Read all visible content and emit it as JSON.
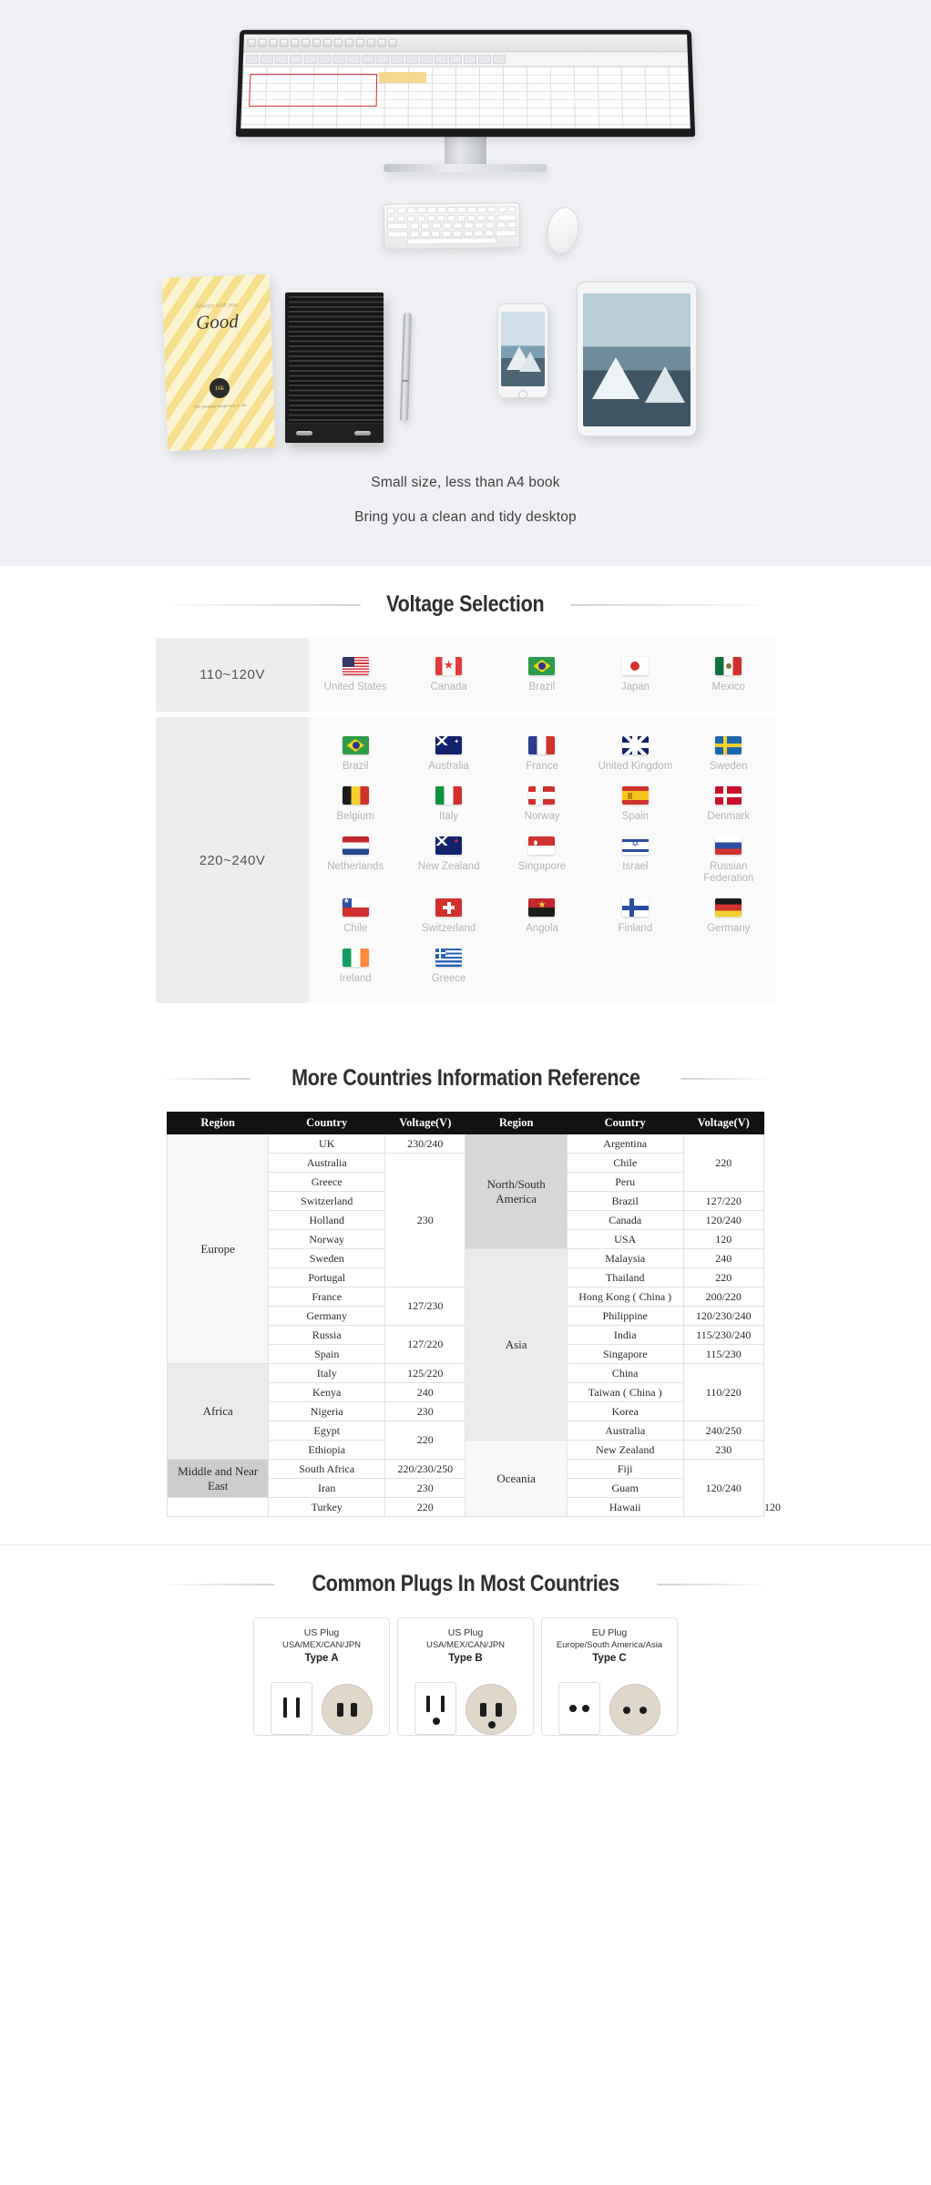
{
  "hero": {
    "caption_1": "Small size, less than A4 book",
    "caption_2": "Bring you a clean and tidy desktop",
    "notebook": {
      "script": "Always with you",
      "title": "Good",
      "badge": "16k",
      "subtitle": "The greatest happiness in life"
    }
  },
  "voltage_section": {
    "title": "Voltage Selection",
    "groups": [
      {
        "label": "110~120V",
        "countries": [
          {
            "name": "United States",
            "flag": "flag-us"
          },
          {
            "name": "Canada",
            "flag": "flag-ca"
          },
          {
            "name": "Brazil",
            "flag": "flag-br"
          },
          {
            "name": "Japan",
            "flag": "flag-jp"
          },
          {
            "name": "Mexico",
            "flag": "flag-mx"
          }
        ]
      },
      {
        "label": "220~240V",
        "countries": [
          {
            "name": "Brazil",
            "flag": "flag-br"
          },
          {
            "name": "Australia",
            "flag": "flag-au"
          },
          {
            "name": "France",
            "flag": "flag-fr"
          },
          {
            "name": "United Kingdom",
            "flag": "flag-uk"
          },
          {
            "name": "Sweden",
            "flag": "flag-se"
          },
          {
            "name": "Belgium",
            "flag": "flag-be"
          },
          {
            "name": "Italy",
            "flag": "flag-it"
          },
          {
            "name": "Norway",
            "flag": "flag-no"
          },
          {
            "name": "Spain",
            "flag": "flag-es"
          },
          {
            "name": "Denmark",
            "flag": "flag-dk"
          },
          {
            "name": "Netherlands",
            "flag": "flag-nl"
          },
          {
            "name": "New Zealand",
            "flag": "flag-nz"
          },
          {
            "name": "Singapore",
            "flag": "flag-sg"
          },
          {
            "name": "Israel",
            "flag": "flag-il"
          },
          {
            "name": "Russian Federation",
            "flag": "flag-ru"
          },
          {
            "name": "Chile",
            "flag": "flag-cl"
          },
          {
            "name": "Switzerland",
            "flag": "flag-ch"
          },
          {
            "name": "Angola",
            "flag": "flag-ao"
          },
          {
            "name": "Finland",
            "flag": "flag-fi"
          },
          {
            "name": "Germany",
            "flag": "flag-de"
          },
          {
            "name": "Ireland",
            "flag": "flag-ie"
          },
          {
            "name": "Greece",
            "flag": "flag-gr"
          }
        ]
      }
    ]
  },
  "reference_section": {
    "title": "More Countries Information Reference",
    "headers": [
      "Region",
      "Country",
      "Voltage(V)",
      "Region",
      "Country",
      "Voltage(V)"
    ],
    "left_regions": [
      {
        "name": "Europe",
        "rowspan": 12,
        "shade": "light"
      },
      {
        "name": "Africa",
        "rowspan": 5,
        "shade": "mid"
      },
      {
        "name": "Middle and Near East",
        "rowspan": 2,
        "shade": "me"
      }
    ],
    "left_rows": [
      {
        "country": "UK",
        "voltage": "230/240",
        "vrowspan": 1
      },
      {
        "country": "Australia",
        "voltage": "230",
        "vrowspan": 7
      },
      {
        "country": "Greece",
        "voltage": null
      },
      {
        "country": "Switzerland",
        "voltage": null
      },
      {
        "country": "Holland",
        "voltage": null
      },
      {
        "country": "Norway",
        "voltage": null
      },
      {
        "country": "Sweden",
        "voltage": null
      },
      {
        "country": "Portugal",
        "voltage": null
      },
      {
        "country": "France",
        "voltage": "127/230",
        "vrowspan": 2
      },
      {
        "country": "Germany",
        "voltage": null
      },
      {
        "country": "Russia",
        "voltage": "127/220",
        "vrowspan": 2
      },
      {
        "country": "Spain",
        "voltage": null
      },
      {
        "country": "Italy",
        "voltage": "125/220",
        "vrowspan": 1
      },
      {
        "country": "Kenya",
        "voltage": "240",
        "vrowspan": 1
      },
      {
        "country": "Nigeria",
        "voltage": "230",
        "vrowspan": 1
      },
      {
        "country": "Egypt",
        "voltage": "220",
        "vrowspan": 2
      },
      {
        "country": "Ethiopia",
        "voltage": null
      },
      {
        "country": "South Africa",
        "voltage": "220/230/250",
        "vrowspan": 1
      },
      {
        "country": "Iran",
        "voltage": "230",
        "vrowspan": 1
      },
      {
        "country": "Turkey",
        "voltage": "220",
        "vrowspan": 1
      }
    ],
    "right_regions": [
      {
        "name": "North/South America",
        "rowspan": 6,
        "shade": "dark"
      },
      {
        "name": "Asia",
        "rowspan": 10,
        "shade": "mid"
      },
      {
        "name": "Oceania",
        "rowspan": 5,
        "shade": "light"
      }
    ],
    "right_rows": [
      {
        "country": "Argentina",
        "voltage": "220",
        "vrowspan": 3
      },
      {
        "country": "Chile",
        "voltage": null
      },
      {
        "country": "Peru",
        "voltage": null
      },
      {
        "country": "Brazil",
        "voltage": "127/220",
        "vrowspan": 1
      },
      {
        "country": "Canada",
        "voltage": "120/240",
        "vrowspan": 1
      },
      {
        "country": "USA",
        "voltage": "120",
        "vrowspan": 1
      },
      {
        "country": "Malaysia",
        "voltage": "240",
        "vrowspan": 1
      },
      {
        "country": "Thailand",
        "voltage": "220",
        "vrowspan": 1
      },
      {
        "country": "Hong Kong ( China )",
        "voltage": "200/220",
        "vrowspan": 1
      },
      {
        "country": "Philippine",
        "voltage": "120/230/240",
        "vrowspan": 1
      },
      {
        "country": "India",
        "voltage": "115/230/240",
        "vrowspan": 1
      },
      {
        "country": "Singapore",
        "voltage": "115/230",
        "vrowspan": 1
      },
      {
        "country": "China",
        "voltage": "110/220",
        "vrowspan": 3
      },
      {
        "country": "Taiwan ( China )",
        "voltage": null
      },
      {
        "country": "Korea",
        "voltage": null
      },
      {
        "country": "Australia",
        "voltage": "240/250",
        "vrowspan": 1
      },
      {
        "country": "New Zealand",
        "voltage": "230",
        "vrowspan": 1
      },
      {
        "country": "Fiji",
        "voltage": "120/240",
        "vrowspan": 3
      },
      {
        "country": "Guam",
        "voltage": null
      },
      {
        "country": "Hawaii",
        "voltage": "120",
        "vrowspan": 1
      }
    ]
  },
  "plugs_section": {
    "title": "Common Plugs In Most Countries",
    "cards": [
      {
        "name": "US Plug",
        "regions": "USA/MEX/CAN/JPN",
        "type": "Type A"
      },
      {
        "name": "US Plug",
        "regions": "USA/MEX/CAN/JPN",
        "type": "Type B"
      },
      {
        "name": "EU Plug",
        "regions": "Europe/South America/Asia",
        "type": "Type C"
      }
    ]
  }
}
